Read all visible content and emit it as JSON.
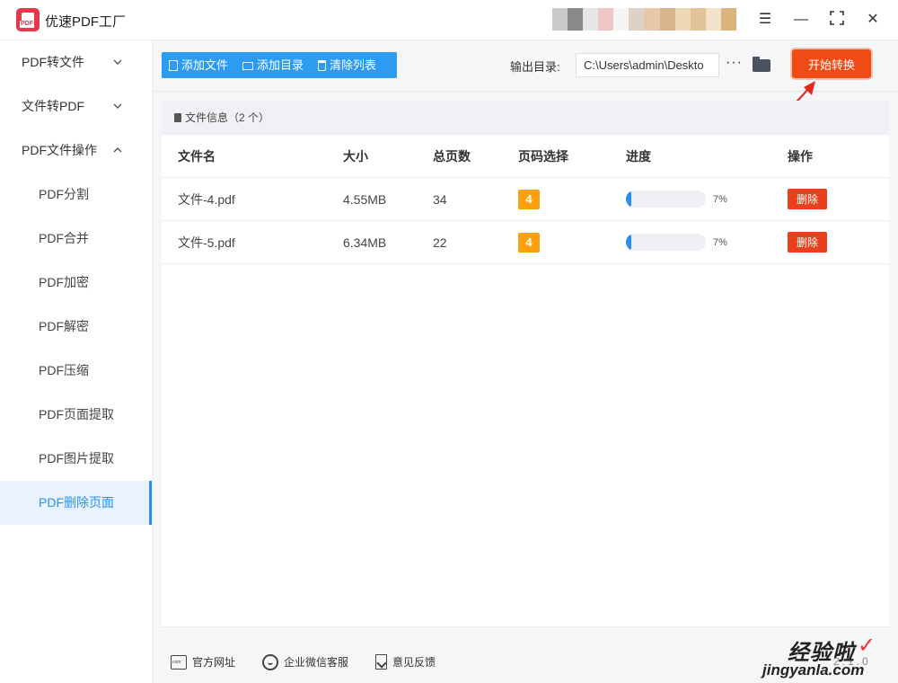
{
  "app": {
    "title": "优速PDF工厂",
    "brand_color": "#e8364f"
  },
  "window_controls": [
    "menu-icon",
    "minimize-icon",
    "maximize-icon",
    "close-icon"
  ],
  "sidebar": {
    "groups": [
      {
        "label": "PDF转文件",
        "expanded": false
      },
      {
        "label": "文件转PDF",
        "expanded": false
      },
      {
        "label": "PDF文件操作",
        "expanded": true
      }
    ],
    "items": [
      {
        "label": "PDF分割"
      },
      {
        "label": "PDF合并"
      },
      {
        "label": "PDF加密"
      },
      {
        "label": "PDF解密"
      },
      {
        "label": "PDF压缩"
      },
      {
        "label": "PDF页面提取"
      },
      {
        "label": "PDF图片提取"
      },
      {
        "label": "PDF删除页面",
        "active": true
      }
    ],
    "accent": "#2b8ff0"
  },
  "toolbar": {
    "add_file": "添加文件",
    "add_folder": "添加目录",
    "clear_list": "清除列表",
    "output_label": "输出目录:",
    "output_path": "C:\\Users\\admin\\Deskto",
    "more": "···",
    "start": "开始转换",
    "start_color": "#f04a16"
  },
  "file_panel": {
    "header": "文件信息（2 个）",
    "columns": [
      "文件名",
      "大小",
      "总页数",
      "页码选择",
      "进度",
      "操作"
    ],
    "rows": [
      {
        "name": "文件-4.pdf",
        "size": "4.55MB",
        "pages": "34",
        "page_select": "4",
        "progress": 0.07,
        "progress_text": "7%",
        "action": "删除"
      },
      {
        "name": "文件-5.pdf",
        "size": "6.34MB",
        "pages": "22",
        "page_select": "4",
        "progress": 0.07,
        "progress_text": "7%",
        "action": "删除"
      }
    ]
  },
  "footer": {
    "website": "官方网址",
    "wechat": "企业微信客服",
    "feedback": "意见反馈",
    "version": "2.1.0"
  },
  "watermark": {
    "cn": "经验啦",
    "en": "jingyanla.com"
  }
}
